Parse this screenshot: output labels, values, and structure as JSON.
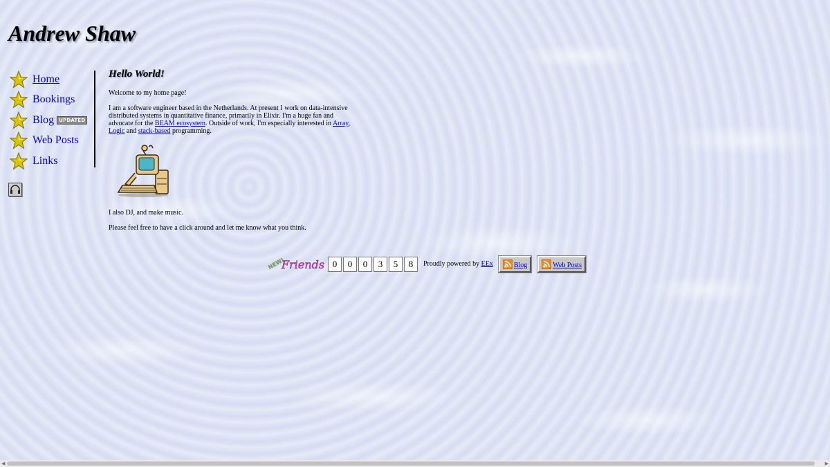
{
  "site_title": "Andrew Shaw",
  "nav": {
    "items": [
      {
        "label": "Home",
        "icon": "star-icon",
        "active": true
      },
      {
        "label": "Bookings",
        "icon": "star-icon"
      },
      {
        "label": "Blog",
        "icon": "star-icon",
        "badge": "UPDATED"
      },
      {
        "label": "Web Posts",
        "icon": "star-icon"
      },
      {
        "label": "Links",
        "icon": "star-icon"
      }
    ],
    "music_icon": "headphones-icon"
  },
  "content": {
    "heading": "Hello World!",
    "welcome": "Welcome to my home page!",
    "bio": {
      "part1": "I am a software engineer based in the Netherlands. At present I work on data-intensive distributed systems in quantitative finance, primarily in Elixir. I'm a huge fan and advocate for the ",
      "link_beam": "BEAM ecosystem",
      "part2": ". Outside of work, I'm especially interested in ",
      "link_array": "Array",
      "comma": ",",
      "link_logic": "Logic",
      "and": " and ",
      "link_stack": "stack-based",
      "part3": " programming."
    },
    "image": "computer-clipart",
    "dj": "I also DJ, and make music.",
    "invite": "Please feel free to have a click around and let me know what you think."
  },
  "footer": {
    "friends_badge": {
      "new": "NEW!",
      "text": "Friends"
    },
    "counter_digits": [
      "0",
      "0",
      "0",
      "3",
      "5",
      "8"
    ],
    "powered_text": "Proudly powered by ",
    "powered_link": "EEx",
    "rss_buttons": [
      "Blog",
      "Web Posts"
    ]
  },
  "colors": {
    "link": "#0000cc",
    "star": "#d8c400"
  }
}
